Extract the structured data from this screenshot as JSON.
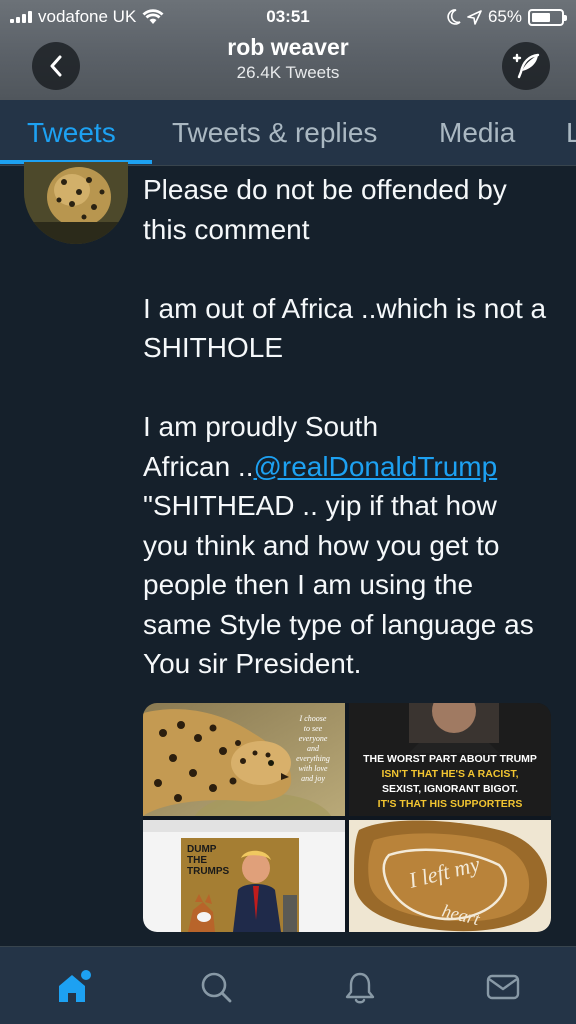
{
  "status_bar": {
    "carrier": "vodafone UK",
    "time": "03:51",
    "battery": "65%",
    "battery_level": 0.65
  },
  "header": {
    "name": "rob weaver",
    "tweet_count": "26.4K Tweets"
  },
  "tabs": [
    {
      "label": "Tweets",
      "active": true
    },
    {
      "label": "Tweets & replies",
      "active": false
    },
    {
      "label": "Media",
      "active": false
    },
    {
      "label": "L",
      "active": false
    }
  ],
  "tweet": {
    "line1": "Please do not be offended by",
    "line2": "this comment",
    "line3": "I am out of Africa ..which is not a",
    "line4": "SHITHOLE",
    "line5": "I am proudly South",
    "line6_prefix": "African ..",
    "mention": "@realDonaldTrump",
    "line7": "\"SHITHEAD .. yip if that how",
    "line8": "you think and how you get to",
    "line9": "people then I am using the",
    "line10": "same Style type of language as",
    "line11": "You sir President."
  },
  "media": {
    "image1_text": [
      "I choose",
      "to see",
      "everyone",
      "and",
      "everything",
      "with love",
      "and joy"
    ],
    "image2_text": [
      "THE WORST PART ABOUT TRUMP",
      "ISN'T THAT HE'S A RACIST,",
      "SEXIST, IGNORANT BIGOT.",
      "IT'S THAT HIS SUPPORTERS"
    ],
    "image3_text": [
      "DUMP",
      "THE",
      "TRUMPS"
    ],
    "image4_text": [
      "I left my",
      "heart"
    ]
  },
  "colors": {
    "background": "#15202b",
    "bar": "#243447",
    "accent": "#1da1f2"
  },
  "nav": [
    "home-icon",
    "search-icon",
    "notifications-icon",
    "messages-icon"
  ]
}
